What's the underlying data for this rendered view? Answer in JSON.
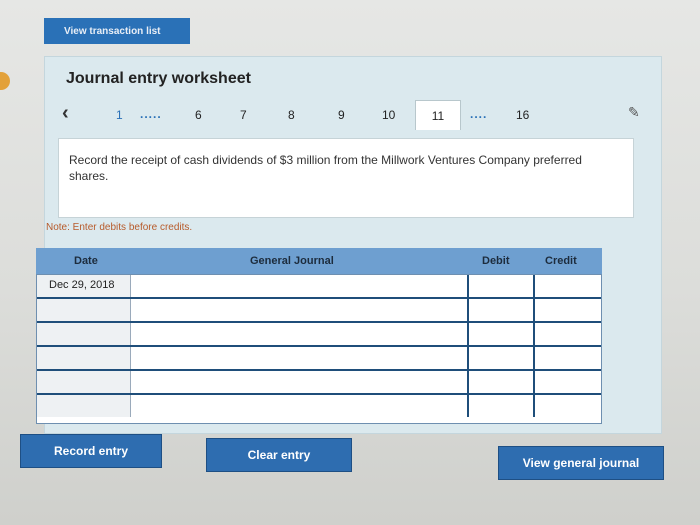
{
  "top_button": {
    "label": "View transaction list"
  },
  "worksheet": {
    "title": "Journal entry worksheet",
    "pager": {
      "prev_icon": "chevron-left-icon",
      "pages": [
        "1",
        "6",
        "7",
        "8",
        "9",
        "10",
        "11",
        "16"
      ],
      "ellipsis": ".....",
      "ellipsis_right": "....",
      "active_page": "11",
      "edit_icon": "pencil-icon"
    },
    "question": "Record the receipt of cash dividends of $3 million from the Millwork Ventures Company preferred shares.",
    "note": "Note: Enter debits before credits."
  },
  "journal": {
    "headers": {
      "date": "Date",
      "general_journal": "General Journal",
      "debit": "Debit",
      "credit": "Credit"
    },
    "rows": [
      {
        "date": "Dec 29, 2018",
        "account": "",
        "debit": "",
        "credit": ""
      },
      {
        "date": "",
        "account": "",
        "debit": "",
        "credit": ""
      },
      {
        "date": "",
        "account": "",
        "debit": "",
        "credit": ""
      },
      {
        "date": "",
        "account": "",
        "debit": "",
        "credit": ""
      },
      {
        "date": "",
        "account": "",
        "debit": "",
        "credit": ""
      },
      {
        "date": "",
        "account": "",
        "debit": "",
        "credit": ""
      }
    ]
  },
  "buttons": {
    "record": "Record entry",
    "clear": "Clear entry",
    "view_journal": "View general journal"
  },
  "colors": {
    "primary": "#2e6db0",
    "header": "#6e9fd0",
    "panel": "#dbe9ee",
    "note": "#b75a2a"
  }
}
